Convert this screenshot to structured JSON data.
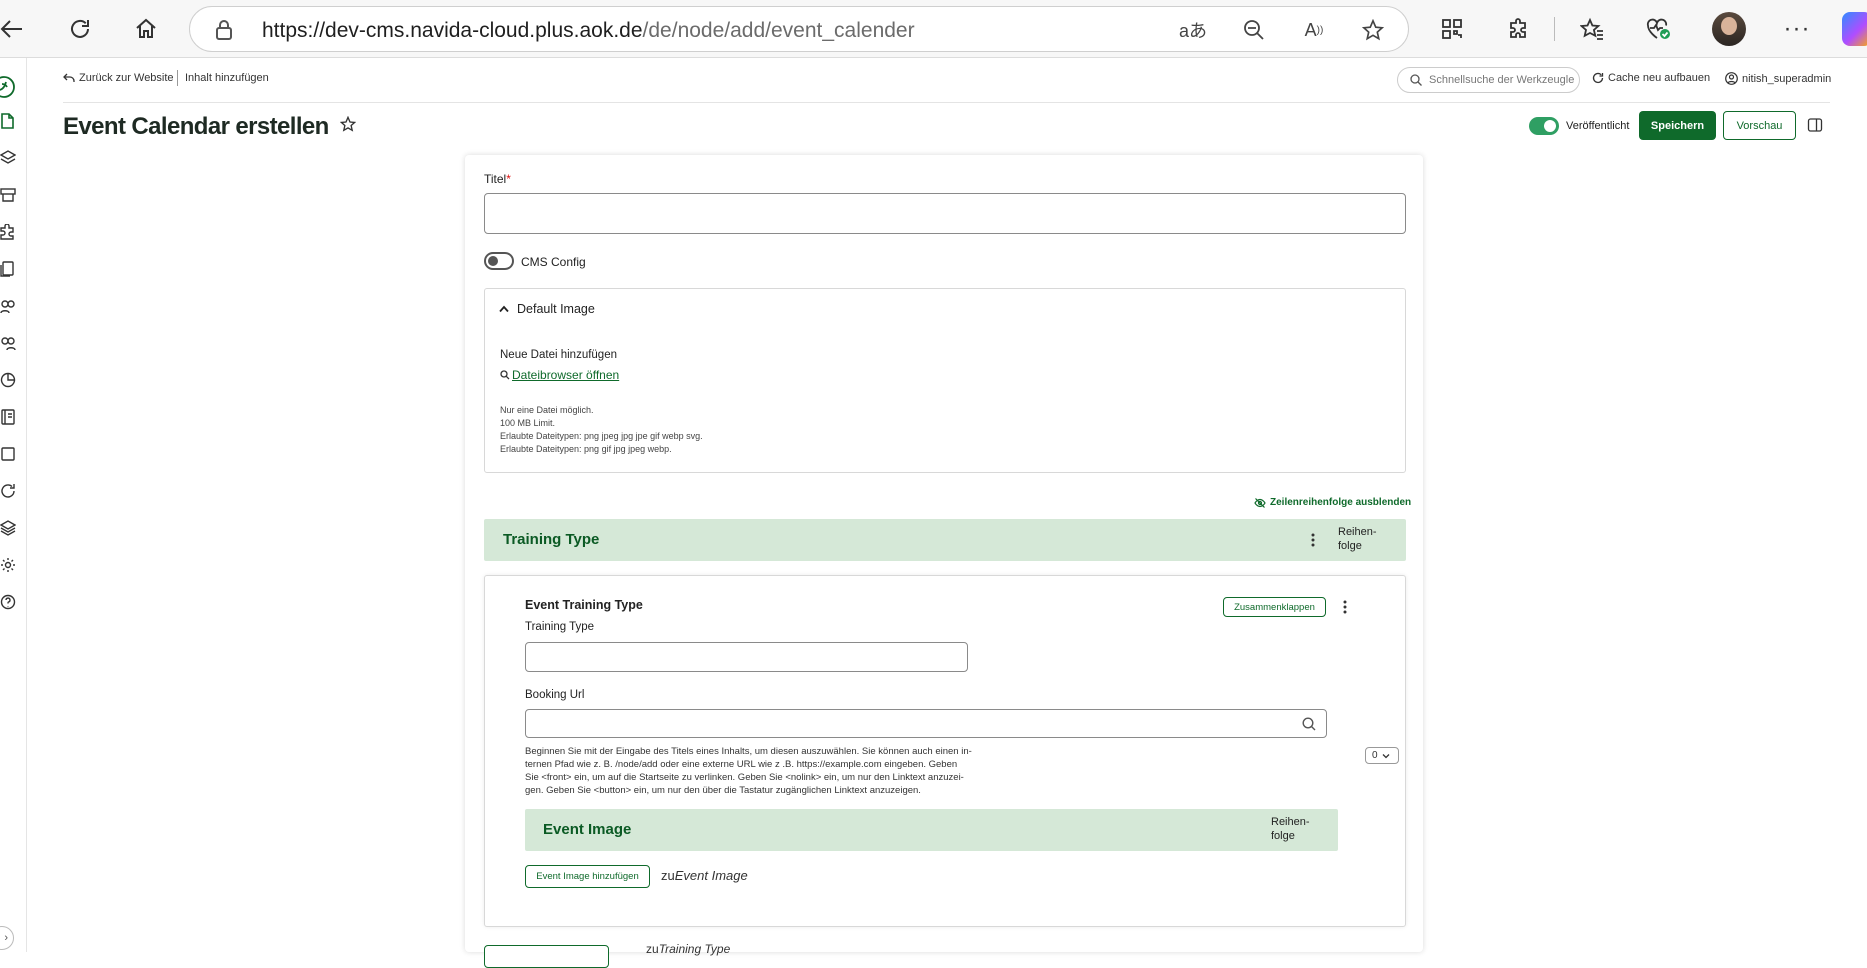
{
  "browser": {
    "url_host": "https://dev-cms.navida-cloud.plus.aok.de",
    "url_path": "/de/node/add/event_calender"
  },
  "toolbar": {
    "back_label": "Zurück zur Website",
    "breadcrumb": "Inhalt hinzufügen",
    "search_placeholder": "Schnellsuche der Werkzeugle",
    "cache_label": "Cache neu aufbauen",
    "user_label": "nitish_superadmin"
  },
  "header": {
    "title": "Event Calendar erstellen",
    "published_label": "Veröffentlicht",
    "save_label": "Speichern",
    "preview_label": "Vorschau"
  },
  "form": {
    "title_label": "Titel",
    "title_required": "*",
    "title_value": "",
    "cms_config_label": "CMS Config",
    "default_image": {
      "heading": "Default Image",
      "add_file_label": "Neue Datei hinzufügen",
      "browser_link": "Dateibrowser öffnen",
      "notes": [
        "Nur eine Datei möglich.",
        "100 MB Limit.",
        "Erlaubte Dateitypen: png jpeg jpg jpe gif webp svg.",
        "Erlaubte Dateitypen: png gif jpg jpeg webp."
      ]
    },
    "row_order_toggle": "Zeilenreihenfolge ausblenden",
    "training_type_section": {
      "title": "Training Type",
      "order_line1": "Reihen-",
      "order_line2": "folge"
    },
    "paragraph": {
      "title": "Event Training Type",
      "collapse_label": "Zusammenklappen",
      "training_type_label": "Training Type",
      "training_type_value": "",
      "booking_url_label": "Booking Url",
      "booking_url_value": "",
      "help_lines": [
        "Beginnen Sie mit der Eingabe des Titels eines Inhalts, um diesen auszuwählen. Sie können auch einen in-",
        "ternen Pfad wie z. B. /node/add oder eine externe URL wie z .B. https://example.com eingeben. Geben",
        "Sie <front> ein, um auf die Startseite zu verlinken. Geben Sie <nolink> ein, um nur den Linktext anzuzei-",
        "gen. Geben Sie <button> ein, um nur den über die Tastatur zugänglichen Linktext anzuzeigen."
      ],
      "weight_value": "0",
      "event_image": {
        "title": "Event Image",
        "order_line1": "Reihen-",
        "order_line2": "folge",
        "add_button": "Event Image hinzufügen",
        "zu_prefix": "zu",
        "zu_target": "Event Image"
      }
    },
    "bottom": {
      "zu_prefix": "zu",
      "zu_target": "Training Type"
    }
  },
  "colors": {
    "brand_green": "#0f6a2b",
    "toggle_green": "#2f9f63",
    "section_bg": "#d5e8d7"
  }
}
